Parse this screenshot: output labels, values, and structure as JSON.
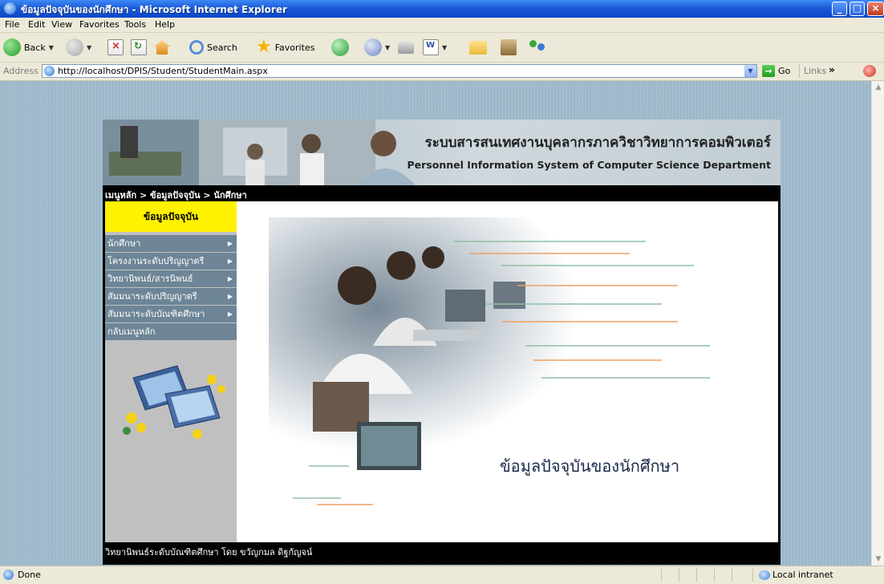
{
  "window": {
    "title": "ข้อมูลปัจจุบันของนักศึกษา - Microsoft Internet Explorer",
    "controls": [
      "minimize",
      "maximize",
      "close"
    ]
  },
  "menubar": {
    "items": [
      {
        "label": "File"
      },
      {
        "label": "Edit"
      },
      {
        "label": "View"
      },
      {
        "label": "Favorites"
      },
      {
        "label": "Tools"
      },
      {
        "label": "Help"
      }
    ]
  },
  "toolbar": {
    "back_label": "Back",
    "search_label": "Search",
    "favorites_label": "Favorites"
  },
  "address": {
    "label": "Address",
    "url": "http://localhost/DPIS/Student/StudentMain.aspx",
    "go_label": "Go",
    "links_label": "Links"
  },
  "page": {
    "banner": {
      "title_th": "ระบบสารสนเทศงานบุคลากรภาควิชาวิทยาการคอมพิวเตอร์",
      "title_en": "Personnel Information System of Computer Science Department"
    },
    "breadcrumb": "เมนูหลัก > ข้อมูลปัจจุบัน > นักศึกษา",
    "sidebar": {
      "header": "ข้อมูลปัจจุบัน",
      "items": [
        {
          "label": "นักศึกษา",
          "has_submenu": true
        },
        {
          "label": "โครงงานระดับปริญญาตรี",
          "has_submenu": true
        },
        {
          "label": "วิทยานิพนธ์/สารนิพนธ์",
          "has_submenu": true
        },
        {
          "label": "สัมมนาระดับปริญญาตรี",
          "has_submenu": true
        },
        {
          "label": "สัมมนาระดับบัณฑิตศึกษา",
          "has_submenu": true
        },
        {
          "label": "กลับเมนูหลัก",
          "has_submenu": false
        }
      ]
    },
    "main_caption": "ข้อมูลปัจจุบันของนักศึกษา",
    "footer": "วิทยานิพนธ์ระดับบัณฑิตศึกษา โดย ขวัญกมล ดิฐกัญจน์"
  },
  "statusbar": {
    "status": "Done",
    "zone": "Local intranet"
  },
  "colors": {
    "title_bar": "#0a46c8",
    "sidebar_header": "#fff200",
    "sidebar_item": "#6d8596",
    "sidebar_bg": "#c0c0c0",
    "page_bg": "#9cb7c9"
  }
}
